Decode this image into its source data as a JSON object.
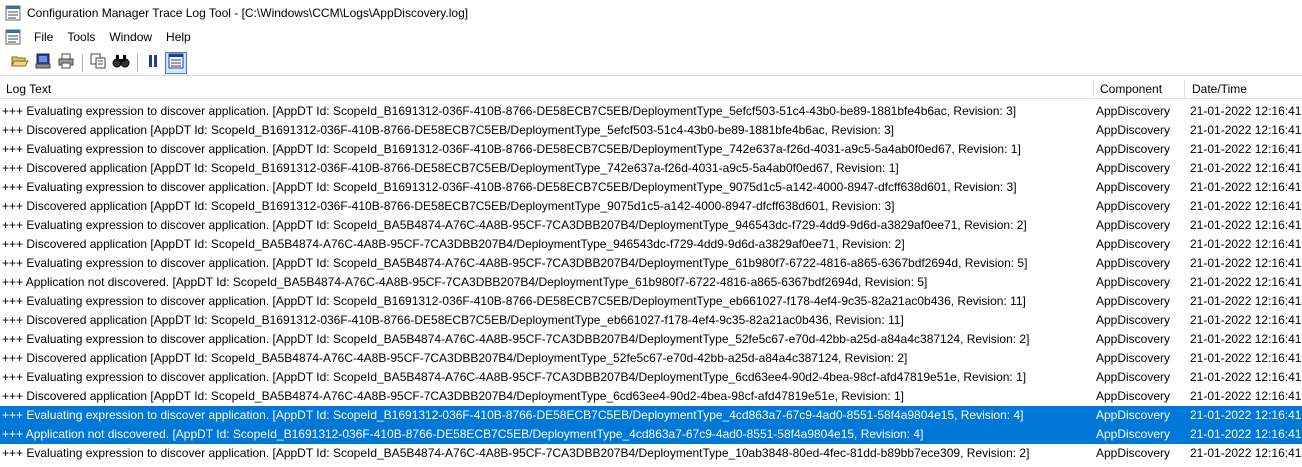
{
  "window": {
    "title": "Configuration Manager Trace Log Tool - [C:\\Windows\\CCM\\Logs\\AppDiscovery.log]"
  },
  "menu": {
    "items": [
      {
        "label": "File"
      },
      {
        "label": "Tools"
      },
      {
        "label": "Window"
      },
      {
        "label": "Help"
      }
    ]
  },
  "toolbar": {
    "buttons": [
      "open-icon",
      "print-preview-icon",
      "print-icon",
      "copy-icon",
      "find-icon",
      "pause-icon",
      "highlight-icon"
    ]
  },
  "table": {
    "headers": {
      "log_text": "Log Text",
      "component": "Component",
      "datetime": "Date/Time"
    },
    "rows": [
      {
        "log": "+++ Evaluating expression to discover application. [AppDT Id: ScopeId_B1691312-036F-410B-8766-DE58ECB7C5EB/DeploymentType_5efcf503-51c4-43b0-be89-1881bfe4b6ac, Revision: 3]",
        "component": "AppDiscovery",
        "datetime": "21-01-2022 12:16:41"
      },
      {
        "log": "+++ Discovered application [AppDT Id: ScopeId_B1691312-036F-410B-8766-DE58ECB7C5EB/DeploymentType_5efcf503-51c4-43b0-be89-1881bfe4b6ac, Revision: 3]",
        "component": "AppDiscovery",
        "datetime": "21-01-2022 12:16:41"
      },
      {
        "log": "+++ Evaluating expression to discover application. [AppDT Id: ScopeId_B1691312-036F-410B-8766-DE58ECB7C5EB/DeploymentType_742e637a-f26d-4031-a9c5-5a4ab0f0ed67, Revision: 1]",
        "component": "AppDiscovery",
        "datetime": "21-01-2022 12:16:41"
      },
      {
        "log": "+++ Discovered application [AppDT Id: ScopeId_B1691312-036F-410B-8766-DE58ECB7C5EB/DeploymentType_742e637a-f26d-4031-a9c5-5a4ab0f0ed67, Revision: 1]",
        "component": "AppDiscovery",
        "datetime": "21-01-2022 12:16:41"
      },
      {
        "log": "+++ Evaluating expression to discover application. [AppDT Id: ScopeId_B1691312-036F-410B-8766-DE58ECB7C5EB/DeploymentType_9075d1c5-a142-4000-8947-dfcff638d601, Revision: 3]",
        "component": "AppDiscovery",
        "datetime": "21-01-2022 12:16:41"
      },
      {
        "log": "+++ Discovered application [AppDT Id: ScopeId_B1691312-036F-410B-8766-DE58ECB7C5EB/DeploymentType_9075d1c5-a142-4000-8947-dfcff638d601, Revision: 3]",
        "component": "AppDiscovery",
        "datetime": "21-01-2022 12:16:41"
      },
      {
        "log": "+++ Evaluating expression to discover application. [AppDT Id: ScopeId_BA5B4874-A76C-4A8B-95CF-7CA3DBB207B4/DeploymentType_946543dc-f729-4dd9-9d6d-a3829af0ee71, Revision: 2]",
        "component": "AppDiscovery",
        "datetime": "21-01-2022 12:16:41"
      },
      {
        "log": "+++ Discovered application [AppDT Id: ScopeId_BA5B4874-A76C-4A8B-95CF-7CA3DBB207B4/DeploymentType_946543dc-f729-4dd9-9d6d-a3829af0ee71, Revision: 2]",
        "component": "AppDiscovery",
        "datetime": "21-01-2022 12:16:41"
      },
      {
        "log": "+++ Evaluating expression to discover application. [AppDT Id: ScopeId_BA5B4874-A76C-4A8B-95CF-7CA3DBB207B4/DeploymentType_61b980f7-6722-4816-a865-6367bdf2694d, Revision: 5]",
        "component": "AppDiscovery",
        "datetime": "21-01-2022 12:16:41"
      },
      {
        "log": "+++ Application not discovered. [AppDT Id: ScopeId_BA5B4874-A76C-4A8B-95CF-7CA3DBB207B4/DeploymentType_61b980f7-6722-4816-a865-6367bdf2694d, Revision: 5]",
        "component": "AppDiscovery",
        "datetime": "21-01-2022 12:16:41"
      },
      {
        "log": "+++ Evaluating expression to discover application. [AppDT Id: ScopeId_B1691312-036F-410B-8766-DE58ECB7C5EB/DeploymentType_eb661027-f178-4ef4-9c35-82a21ac0b436, Revision: 11]",
        "component": "AppDiscovery",
        "datetime": "21-01-2022 12:16:41"
      },
      {
        "log": "+++ Discovered application [AppDT Id: ScopeId_B1691312-036F-410B-8766-DE58ECB7C5EB/DeploymentType_eb661027-f178-4ef4-9c35-82a21ac0b436, Revision: 11]",
        "component": "AppDiscovery",
        "datetime": "21-01-2022 12:16:41"
      },
      {
        "log": "+++ Evaluating expression to discover application. [AppDT Id: ScopeId_BA5B4874-A76C-4A8B-95CF-7CA3DBB207B4/DeploymentType_52fe5c67-e70d-42bb-a25d-a84a4c387124, Revision: 2]",
        "component": "AppDiscovery",
        "datetime": "21-01-2022 12:16:41"
      },
      {
        "log": "+++ Discovered application [AppDT Id: ScopeId_BA5B4874-A76C-4A8B-95CF-7CA3DBB207B4/DeploymentType_52fe5c67-e70d-42bb-a25d-a84a4c387124, Revision: 2]",
        "component": "AppDiscovery",
        "datetime": "21-01-2022 12:16:41"
      },
      {
        "log": "+++ Evaluating expression to discover application. [AppDT Id: ScopeId_BA5B4874-A76C-4A8B-95CF-7CA3DBB207B4/DeploymentType_6cd63ee4-90d2-4bea-98cf-afd47819e51e, Revision: 1]",
        "component": "AppDiscovery",
        "datetime": "21-01-2022 12:16:41"
      },
      {
        "log": "+++ Discovered application [AppDT Id: ScopeId_BA5B4874-A76C-4A8B-95CF-7CA3DBB207B4/DeploymentType_6cd63ee4-90d2-4bea-98cf-afd47819e51e, Revision: 1]",
        "component": "AppDiscovery",
        "datetime": "21-01-2022 12:16:41"
      },
      {
        "log": "+++ Evaluating expression to discover application. [AppDT Id: ScopeId_B1691312-036F-410B-8766-DE58ECB7C5EB/DeploymentType_4cd863a7-67c9-4ad0-8551-58f4a9804e15, Revision: 4]",
        "component": "AppDiscovery",
        "datetime": "21-01-2022 12:16:41",
        "selected": true
      },
      {
        "log": "+++ Application not discovered. [AppDT Id: ScopeId_B1691312-036F-410B-8766-DE58ECB7C5EB/DeploymentType_4cd863a7-67c9-4ad0-8551-58f4a9804e15, Revision: 4]",
        "component": "AppDiscovery",
        "datetime": "21-01-2022 12:16:41",
        "selected": true
      },
      {
        "log": "+++ Evaluating expression to discover application. [AppDT Id: ScopeId_BA5B4874-A76C-4A8B-95CF-7CA3DBB207B4/DeploymentType_10ab3848-80ed-4fec-81dd-b89bb7ece309, Revision: 2]",
        "component": "AppDiscovery",
        "datetime": "21-01-2022 12:16:41"
      }
    ]
  },
  "colors": {
    "selection": "#0078d7"
  }
}
